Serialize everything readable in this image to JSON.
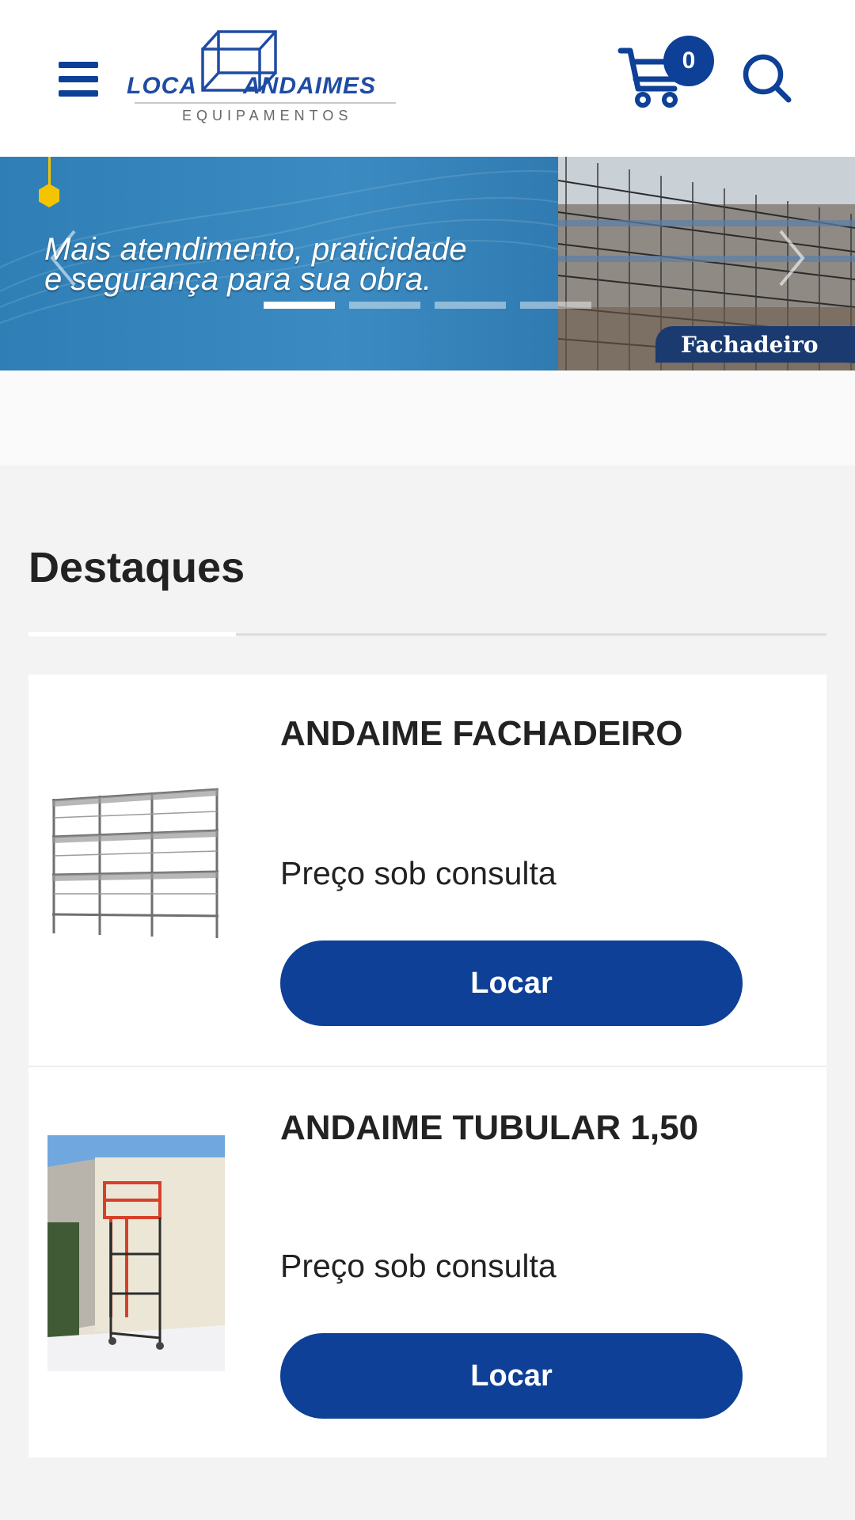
{
  "header": {
    "logo": {
      "word_left": "LOCA",
      "word_right": "ANDAIMES",
      "subtitle": "EQUIPAMENTOS"
    },
    "cart_count": "0",
    "icons": [
      "menu-icon",
      "cart-icon",
      "search-icon"
    ],
    "accent_color": "#0d4096"
  },
  "banner": {
    "text_line1": "Mais atendimento, praticidade",
    "text_line2": "e segurança para sua obra.",
    "tag": "Fachadeiro",
    "slides": 4,
    "active_slide": 1
  },
  "featured": {
    "title": "Destaques",
    "products": [
      {
        "name": "ANDAIME FACHADEIRO",
        "price": "Preço sob consulta",
        "button": "Locar"
      },
      {
        "name": "ANDAIME TUBULAR 1,50",
        "price": "Preço sob consulta",
        "button": "Locar"
      }
    ]
  }
}
